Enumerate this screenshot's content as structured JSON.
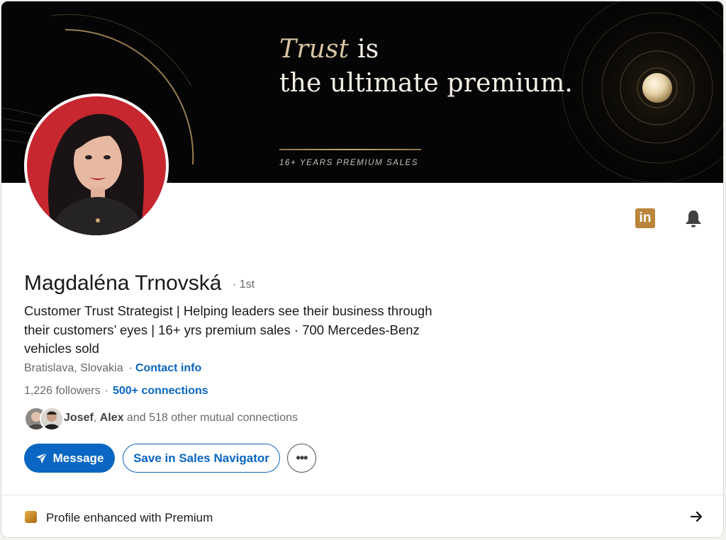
{
  "banner": {
    "tagline_word1": "Trust",
    "tagline_word2": " is",
    "tagline_line2": "the ultimate premium.",
    "subtitle": "16+ YEARS PREMIUM SALES"
  },
  "profile": {
    "name": "Magdaléna Trnovská",
    "degree": "· 1st",
    "headline": "Customer Trust Strategist | Helping leaders see their business through their customers’ eyes | 16+ yrs premium sales · 700 Mercedes-Benz vehicles sold",
    "location": "Bratislava, Slovakia",
    "contact_info": "Contact info",
    "followers": "1,226 followers",
    "connections": "500+ connections",
    "mutual": {
      "name1": "Josef",
      "name2": "Alex",
      "rest": " and 518 other mutual connections"
    }
  },
  "actions": {
    "message": "Message",
    "save_sales_navigator": "Save in Sales Navigator",
    "more": "•••"
  },
  "premium": {
    "label": "Profile enhanced with Premium"
  },
  "colors": {
    "primary": "#0a66c2",
    "banner_bg": "#050505",
    "gold": "#b9853a",
    "avatar_bg": "#c7272f"
  },
  "icons": [
    "linkedin-icon",
    "bell-icon",
    "send-icon",
    "premium-icon",
    "arrow-right-icon"
  ]
}
